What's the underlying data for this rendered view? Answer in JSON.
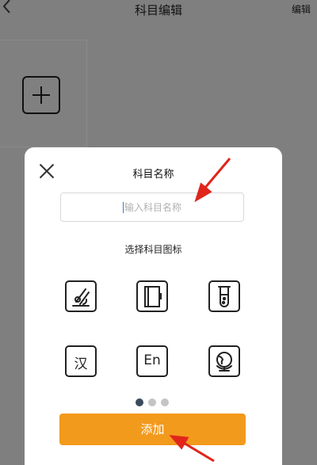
{
  "header": {
    "title": "科目编辑",
    "edit_label": "编辑"
  },
  "dialog": {
    "title": "科目名称",
    "input_placeholder": "输入科目名称",
    "section_label": "选择科目图标",
    "icons": [
      {
        "name": "microscope-icon"
      },
      {
        "name": "book-icon"
      },
      {
        "name": "test-tube-icon"
      },
      {
        "name": "chinese-icon",
        "text": "汉"
      },
      {
        "name": "english-icon",
        "text": "En"
      },
      {
        "name": "globe-icon"
      }
    ],
    "pagination": {
      "count": 3,
      "active": 0
    },
    "add_label": "添加"
  },
  "colors": {
    "accent": "#f29a1c",
    "annotation_arrow": "#e1251b",
    "dot_active": "#3b4a5a",
    "dot_inactive": "#c4c4c4"
  }
}
